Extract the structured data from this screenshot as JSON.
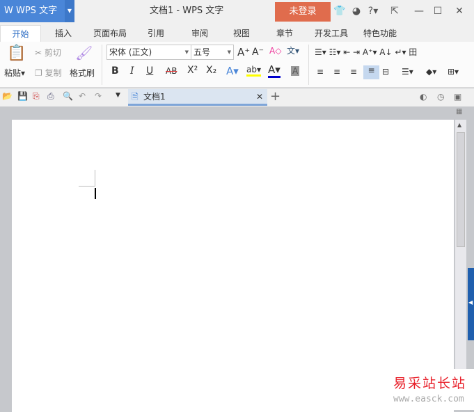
{
  "app": {
    "logo": "W WPS 文字",
    "title": "文档1 - WPS 文字",
    "login": "未登录"
  },
  "tabs": [
    "开始",
    "插入",
    "页面布局",
    "引用",
    "审阅",
    "视图",
    "章节",
    "开发工具",
    "特色功能"
  ],
  "ribbon": {
    "paste": "粘贴",
    "cut": "剪切",
    "copy": "复制",
    "format_painter": "格式刷",
    "font": "宋体 (正文)",
    "size": "五号",
    "bold": "B",
    "italic": "I",
    "underline": "U",
    "strike": "AB",
    "sup": "X²",
    "sub": "X₂"
  },
  "doc_tab": {
    "label": "文档1"
  },
  "watermark": {
    "name": "易采站长站",
    "url": "www.easck.com"
  },
  "colors": {
    "brand": "#4a86d8",
    "login": "#e06c4d",
    "highlight": "#ffff00",
    "font_color": "#0000cc"
  }
}
